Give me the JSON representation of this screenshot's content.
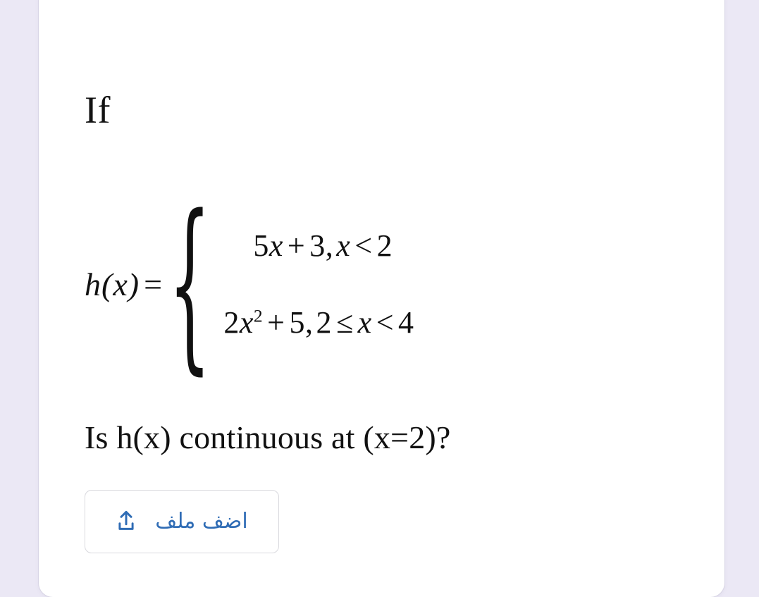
{
  "page": {
    "background_color": "#ebe8f5",
    "card_color": "#ffffff",
    "text_color": "#111111"
  },
  "content": {
    "intro": "If",
    "question": "Is h(x) continuous at (x=2)?"
  },
  "equation": {
    "lhs_function": "h(x)",
    "equals_sign": "=",
    "brace": "{",
    "cases": [
      {
        "expression_coefficient": "5",
        "expression_var": "x",
        "expression_op": "+",
        "expression_constant": "3",
        "comma": ",",
        "condition_var": "x",
        "condition_op": "<",
        "condition_value": "2",
        "plain": "5x + 3 , x < 2"
      },
      {
        "expression_coefficient": "2",
        "expression_var": "x",
        "expression_exponent": "2",
        "expression_op": "+",
        "expression_constant": "5",
        "comma": ",",
        "condition_lower": "2",
        "condition_lower_op": "≤",
        "condition_var": "x",
        "condition_upper_op": "<",
        "condition_upper": "4",
        "plain": "2x² + 5 , 2 ≤ x < 4"
      }
    ]
  },
  "upload": {
    "label": "اضف ملف",
    "icon": "upload-icon",
    "accent_color": "#2f6cb5",
    "border_color": "#d9d9de"
  }
}
